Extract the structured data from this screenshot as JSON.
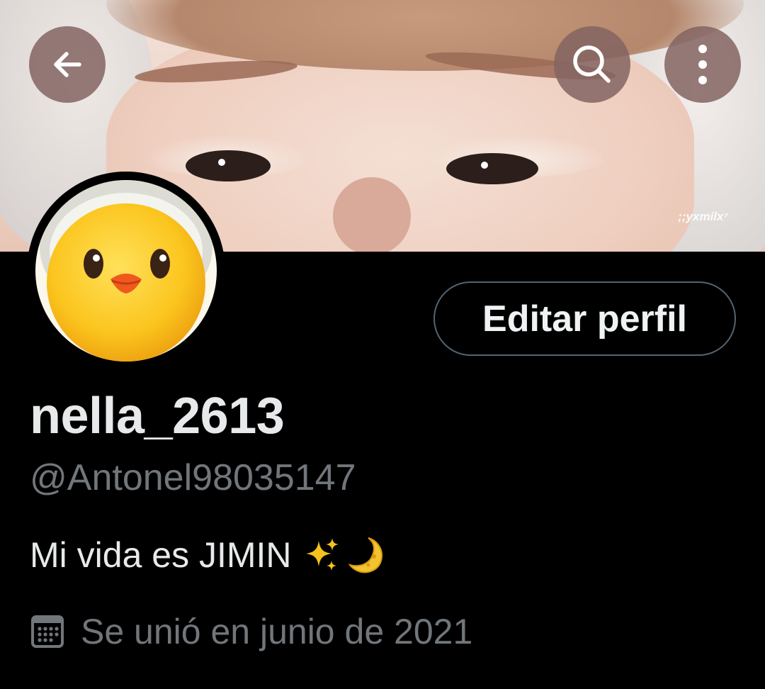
{
  "header": {
    "back_icon": "arrow-left-icon",
    "search_icon": "search-icon",
    "more_icon": "more-vertical-icon",
    "button_bg": "#846462"
  },
  "banner": {
    "watermark": ";;yxmilx⁷"
  },
  "avatar": {
    "icon": "baby-chick-emoji"
  },
  "profile": {
    "edit_label": "Editar perfil",
    "display_name": "nella_2613",
    "handle": "@Antonel98035147",
    "bio_text": "Mi vida es JIMIN",
    "bio_emojis": [
      "sparkles-emoji",
      "crescent-moon-emoji"
    ],
    "joined_icon": "calendar-icon",
    "joined_text": "Se unió en junio de 2021"
  },
  "colors": {
    "background": "#000000",
    "primary_text": "#e7e9ea",
    "secondary_text": "#71767b",
    "button_border": "#536471"
  }
}
